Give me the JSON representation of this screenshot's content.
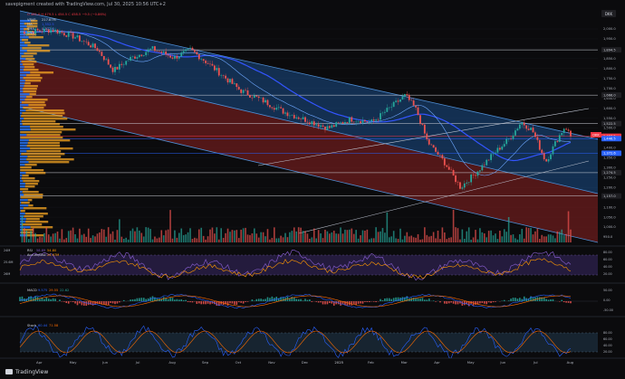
{
  "header": {
    "caption": "savepigment created with TradingView.com, Jul 30, 2025 10:56 UTC+2"
  },
  "symbol_badge": "DKK",
  "legend": {
    "main": "O 461.0  H 479.5  L 454.5  C 458.5  −9.5 (−0.86%)",
    "vrvp": "VRVP",
    "vrvp_value": "217.87M",
    "ma1": "MA",
    "ma1_value": "1,352.5",
    "ma2": "SMA",
    "ma2_value": "1,372.6",
    "ma3": "SMA",
    "rsi_label": "RSI",
    "rsi_value": "58.89",
    "rsi_value2": "54.80",
    "ao_label": "Accum/Dist",
    "ao_value": "24.97M",
    "macd_label": "MACD",
    "macd_v1": "9.575",
    "macd_v2": "29.55",
    "macd_v3": "22.62",
    "stoch_label": "Stoch",
    "stoch_v1": "60.44",
    "stoch_v2": "71.58"
  },
  "price_axis": {
    "ticks": [
      "2,000.0",
      "1,950.0",
      "1,900.0",
      "1,850.0",
      "1,800.0",
      "1,750.0",
      "1,700.0",
      "1,650.0",
      "1,600.0",
      "1,550.0",
      "1,500.0",
      "1,450.0",
      "1,400.0",
      "1,350.0",
      "1,300.0",
      "1,250.0",
      "1,200.0",
      "1,150.0",
      "1,100.0",
      "1,050.0",
      "1,000.0",
      "950.0"
    ],
    "badges": [
      {
        "label": "1,894.5",
        "color": "#1f1f23",
        "text_color": "#d1d4dc",
        "price": 1894.5
      },
      {
        "label": "1,666.0",
        "color": "#1f1f23",
        "text_color": "#d1d4dc",
        "price": 1666.0
      },
      {
        "label": "1,522.5",
        "color": "#1f1f23",
        "text_color": "#d1d4dc",
        "price": 1522.5
      },
      {
        "label": "1,458.5",
        "color": "#f23645",
        "text_color": "#ffffff",
        "price": 1458.5
      },
      {
        "label": "1,446.5",
        "color": "#2962ff",
        "text_color": "#ffffff",
        "price": 1446.5
      },
      {
        "label": "1,372.6",
        "color": "#2962ff",
        "text_color": "#ffffff",
        "price": 1372.6
      },
      {
        "label": "1,274.5",
        "color": "#1f1f23",
        "text_color": "#d1d4dc",
        "price": 1274.5
      },
      {
        "label": "1,157.0",
        "color": "#1f1f23",
        "text_color": "#d1d4dc",
        "price": 1157.0
      }
    ],
    "red_tag": "DKK"
  },
  "indicator_axes": {
    "rsi": [
      "80.00",
      "60.00",
      "40.00",
      "20.00"
    ],
    "rsi_left": [
      "24M",
      "25.6M",
      "26M"
    ],
    "macd": [
      "50.00",
      "0.00",
      "-50.00"
    ],
    "stoch": [
      "80.00",
      "60.00",
      "40.00",
      "20.00"
    ]
  },
  "time_axis": [
    "Apr",
    "May",
    "Jun",
    "Jul",
    "Aug",
    "Sep",
    "Oct",
    "Nov",
    "Dec",
    "2025",
    "Feb",
    "Mar",
    "Apr",
    "May",
    "Jun",
    "Jul",
    "Aug"
  ],
  "colors": {
    "up": "#26a69a",
    "down": "#ef5350",
    "channel_blue": "#2962ff",
    "channel_red": "#c62828",
    "ma_blue": "#3355ff",
    "volume_profile_orange": "#f5a623",
    "volume_profile_blue": "#2979ff",
    "rsi_line": "#7e57c2",
    "rsi_bg": "#2a1f4a",
    "macd_line": "#2962ff",
    "signal_line": "#ff6d00",
    "stoch_k": "#2962ff",
    "stoch_d": "#ff6d00"
  },
  "footer": {
    "logo": "TradingView"
  }
}
